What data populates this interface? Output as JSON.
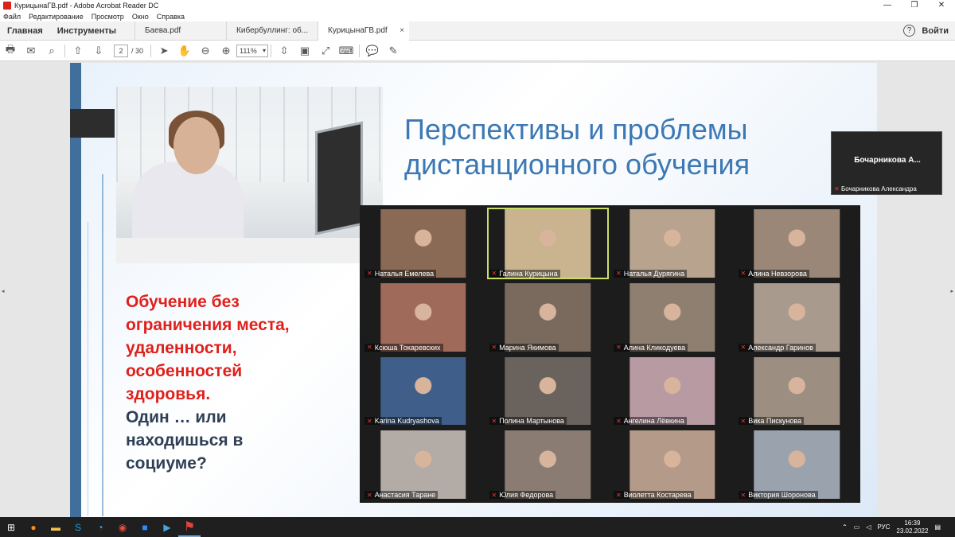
{
  "window": {
    "title": "КурицынаГВ.pdf - Adobe Acrobat Reader DC",
    "minimize": "—",
    "restore": "❐",
    "close": "✕"
  },
  "menu": [
    "Файл",
    "Редактирование",
    "Просмотр",
    "Окно",
    "Справка"
  ],
  "tabs": {
    "home": "Главная",
    "tools": "Инструменты",
    "docs": [
      {
        "label": "Баева.pdf",
        "active": false
      },
      {
        "label": "Кибербуллинг: об...",
        "active": false
      },
      {
        "label": "КурицынаГВ.pdf",
        "active": true
      }
    ],
    "help": "?",
    "signin": "Войти",
    "close": "×"
  },
  "toolbar": {
    "page": "2",
    "total": "/ 30",
    "zoom": "111%"
  },
  "slide": {
    "title_line1": "Перспективы и проблемы",
    "title_line2": "дистанционного обучения",
    "red_text": "Обучение без\nограничения места,\nудаленности,\nособенностей\nздоровья.",
    "dark_text": "      Один … или\nнаходишься в\nсоциуме?"
  },
  "participants": [
    {
      "name": "Наталья Емелева",
      "bg": "#8a6a55"
    },
    {
      "name": "Галина Курицына",
      "bg": "#c9b48f",
      "active": true
    },
    {
      "name": "Наталья Дурягина",
      "bg": "#b8a38f"
    },
    {
      "name": "Алина Невзорова",
      "bg": "#9a8778"
    },
    {
      "name": "Ксюша Токаревских",
      "bg": "#a06a5a"
    },
    {
      "name": "Марина Якимова",
      "bg": "#7a6a5e"
    },
    {
      "name": "Алина Кликодуева",
      "bg": "#8f7f70"
    },
    {
      "name": "Александр Гаринов",
      "bg": "#a89a8c"
    },
    {
      "name": "Karina Kudryashova",
      "bg": "#3f5f8a"
    },
    {
      "name": "Полина Мартынова",
      "bg": "#6a625c"
    },
    {
      "name": "Ангелина Лёвкина",
      "bg": "#b89aa3"
    },
    {
      "name": "Вика Пискунова",
      "bg": "#9c8f82"
    },
    {
      "name": "Анастасия Таране",
      "bg": "#b3aba6"
    },
    {
      "name": "Юлия Федорова",
      "bg": "#8a7c72"
    },
    {
      "name": "Виолетта Костарева",
      "bg": "#b49a88"
    },
    {
      "name": "Виктория Шоронова",
      "bg": "#9aa3ad"
    }
  ],
  "float_video": {
    "center": "Бочарникова А...",
    "name": "Бочарникова Александра"
  },
  "taskbar": {
    "lang": "РУС",
    "time": "16:39",
    "date": "23.02.2022"
  }
}
